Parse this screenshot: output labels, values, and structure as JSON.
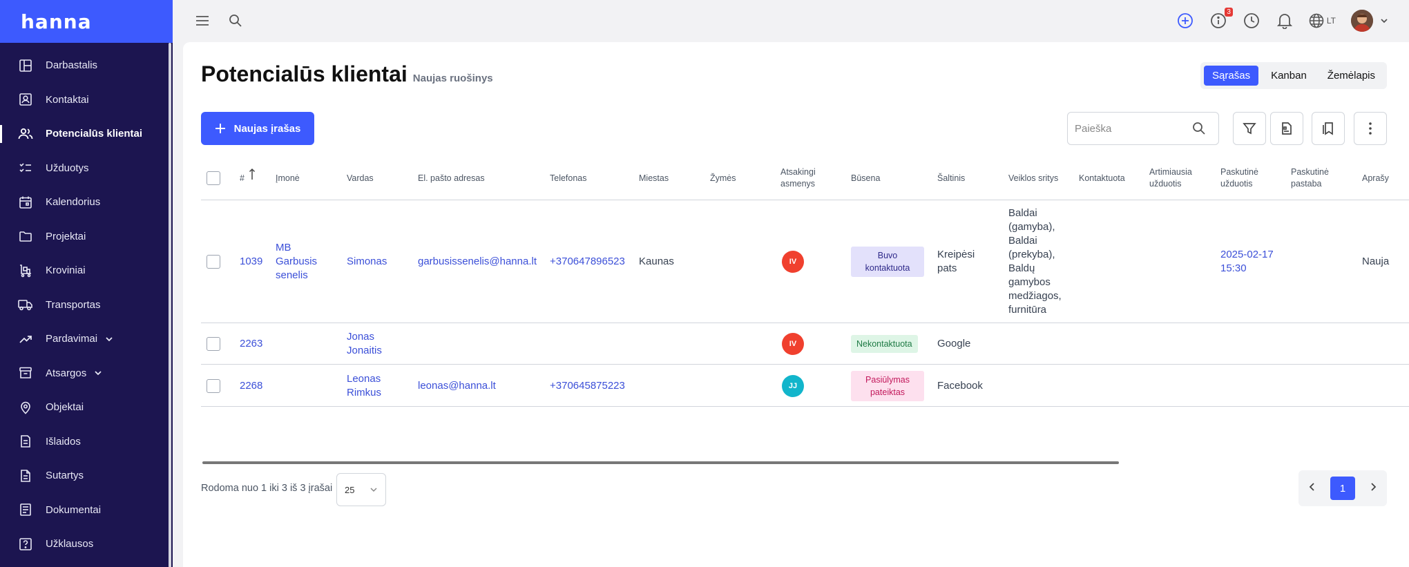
{
  "app": {
    "logo": "hanna"
  },
  "sidebar": {
    "items": [
      {
        "label": "Darbastalis",
        "icon": "dashboard-icon"
      },
      {
        "label": "Kontaktai",
        "icon": "contacts-icon"
      },
      {
        "label": "Potencialūs klientai",
        "icon": "users-icon",
        "active": true
      },
      {
        "label": "Užduotys",
        "icon": "tasks-icon"
      },
      {
        "label": "Kalendorius",
        "icon": "calendar-icon"
      },
      {
        "label": "Projektai",
        "icon": "folder-icon"
      },
      {
        "label": "Kroviniai",
        "icon": "cargo-icon"
      },
      {
        "label": "Transportas",
        "icon": "truck-icon"
      },
      {
        "label": "Pardavimai",
        "icon": "trend-icon",
        "expandable": true
      },
      {
        "label": "Atsargos",
        "icon": "archive-icon",
        "expandable": true
      },
      {
        "label": "Objektai",
        "icon": "location-pin-icon"
      },
      {
        "label": "Išlaidos",
        "icon": "receipt-icon"
      },
      {
        "label": "Sutartys",
        "icon": "contract-icon"
      },
      {
        "label": "Dokumentai",
        "icon": "document-icon"
      },
      {
        "label": "Užklausos",
        "icon": "question-icon"
      }
    ]
  },
  "topbar": {
    "notification_count": "3",
    "language": "LT"
  },
  "header": {
    "title": "Potencialūs klientai",
    "subtitle": "Naujas ruošinys",
    "views": [
      "Sąrašas",
      "Kanban",
      "Žemėlapis"
    ],
    "active_view": "Sąrašas"
  },
  "toolbar": {
    "new_label": "Naujas įrašas",
    "search_placeholder": "Paieška"
  },
  "table": {
    "columns": {
      "num": "#",
      "company": "Įmonė",
      "name": "Vardas",
      "email": "El. pašto adresas",
      "phone": "Telefonas",
      "city": "Miestas",
      "tags": "Žymės",
      "responsible": "Atsakingi asmenys",
      "status": "Būsena",
      "source": "Šaltinis",
      "fields": "Veiklos sritys",
      "contacted": "Kontaktuota",
      "next_task": "Artimiausia užduotis",
      "last_task": "Paskutinė užduotis",
      "last_note": "Paskutinė pastaba",
      "desc": "Aprašy"
    },
    "rows": [
      {
        "num": "1039",
        "company": "MB Garbusis senelis",
        "name": "Simonas",
        "email": "garbusissenelis@hanna.lt",
        "phone": "+370647896523",
        "city": "Kaunas",
        "responsible": "IV",
        "responsible_color": "#f0402e",
        "status": "Buvo kontaktuota",
        "status_bg": "#e3e1fb",
        "status_fg": "#2f2a8a",
        "source": "Kreipėsi pats",
        "fields": "Baldai (gamyba), Baldai (prekyba), Baldų gamybos medžiagos, furnitūra",
        "last_task": "2025-02-17 15:30",
        "desc": "Nauja"
      },
      {
        "num": "2263",
        "company": "",
        "name": "Jonas Jonaitis",
        "email": "",
        "phone": "",
        "city": "",
        "responsible": "IV",
        "responsible_color": "#f0402e",
        "status": "Nekontaktuota",
        "status_bg": "#def5e6",
        "status_fg": "#1e7a44",
        "source": "Google",
        "fields": "",
        "last_task": "",
        "desc": ""
      },
      {
        "num": "2268",
        "company": "",
        "name": "Leonas Rimkus",
        "email": "leonas@hanna.lt",
        "phone": "+370645875223",
        "city": "",
        "responsible": "JJ",
        "responsible_color": "#12b5cb",
        "status": "Pasiūlymas pateiktas",
        "status_bg": "#fde0ee",
        "status_fg": "#c2185b",
        "source": "Facebook",
        "fields": "",
        "last_task": "",
        "desc": ""
      }
    ]
  },
  "footer": {
    "summary": "Rodoma nuo 1 iki 3 iš 3 įrašai",
    "per_page": "25",
    "current_page": "1"
  }
}
